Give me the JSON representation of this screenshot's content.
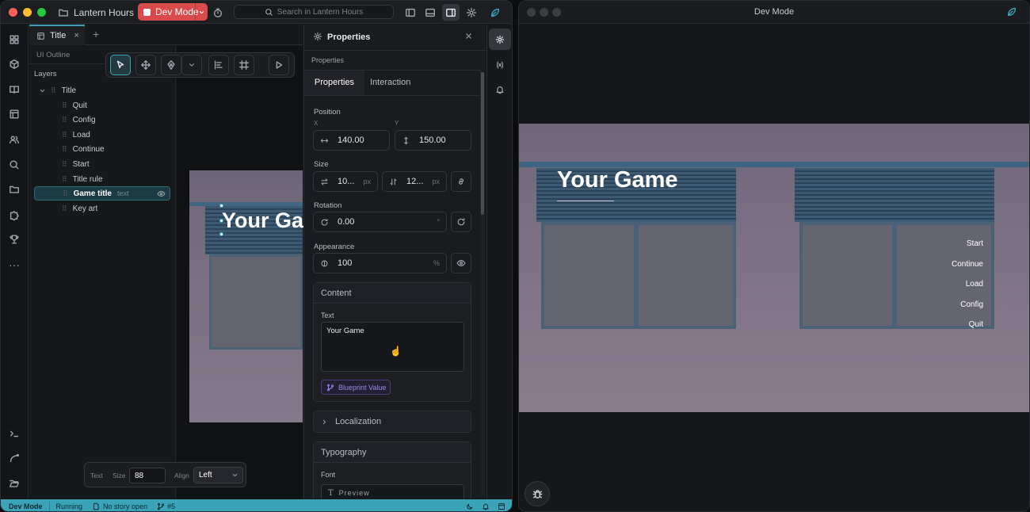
{
  "app": {
    "project_name": "Lantern Hours",
    "mode_badge": "Dev Mode",
    "search_placeholder": "Search in Lantern Hours"
  },
  "editor": {
    "tab_title": "Title",
    "tab_close": "×",
    "tab_add": "+",
    "outline_label": "UI Outline",
    "layers_label": "Layers",
    "layers": [
      {
        "label": "Title",
        "type": ""
      },
      {
        "label": "Quit",
        "type": ""
      },
      {
        "label": "Config",
        "type": ""
      },
      {
        "label": "Load",
        "type": ""
      },
      {
        "label": "Continue",
        "type": ""
      },
      {
        "label": "Start",
        "type": ""
      },
      {
        "label": "Title rule",
        "type": ""
      },
      {
        "label": "Game title",
        "type": "text"
      },
      {
        "label": "Key art",
        "type": ""
      }
    ],
    "canvas_preview_text": "Your Game"
  },
  "textbar": {
    "text_label": "Text",
    "size_label": "Size",
    "size_value": "88",
    "align_label": "Align",
    "align_value": "Left"
  },
  "properties": {
    "header": "Properties",
    "section_caption": "Properties",
    "tabs": [
      "Properties",
      "Interaction"
    ],
    "position_label": "Position",
    "x_label": "X",
    "y_label": "Y",
    "x_value": "140.00",
    "y_value": "150.00",
    "size_label": "Size",
    "width_value": "10...",
    "height_value": "12...",
    "px_unit": "px",
    "rotation_label": "Rotation",
    "rotation_value": "0.00",
    "deg_unit": "°",
    "appearance_label": "Appearance",
    "opacity_value": "100",
    "pct_unit": "%",
    "content_header": "Content",
    "text_label": "Text",
    "text_value": "Your Game",
    "blueprint_button": "Blueprint Value",
    "localization_header": "Localization",
    "typography_header": "Typography",
    "font_label": "Font",
    "font_value": "Preview"
  },
  "statusbar": {
    "mode": "Dev Mode",
    "state": "Running",
    "story": "No story open",
    "branch": "#5"
  },
  "preview": {
    "window_title": "Dev Mode",
    "game_title": "Your Game",
    "menu": [
      "Start",
      "Continue",
      "Load",
      "Config",
      "Quit"
    ]
  },
  "colors": {
    "accent": "#3aa3b8",
    "mode_red": "#d94b4b",
    "status_bar": "#3aa3b8"
  }
}
